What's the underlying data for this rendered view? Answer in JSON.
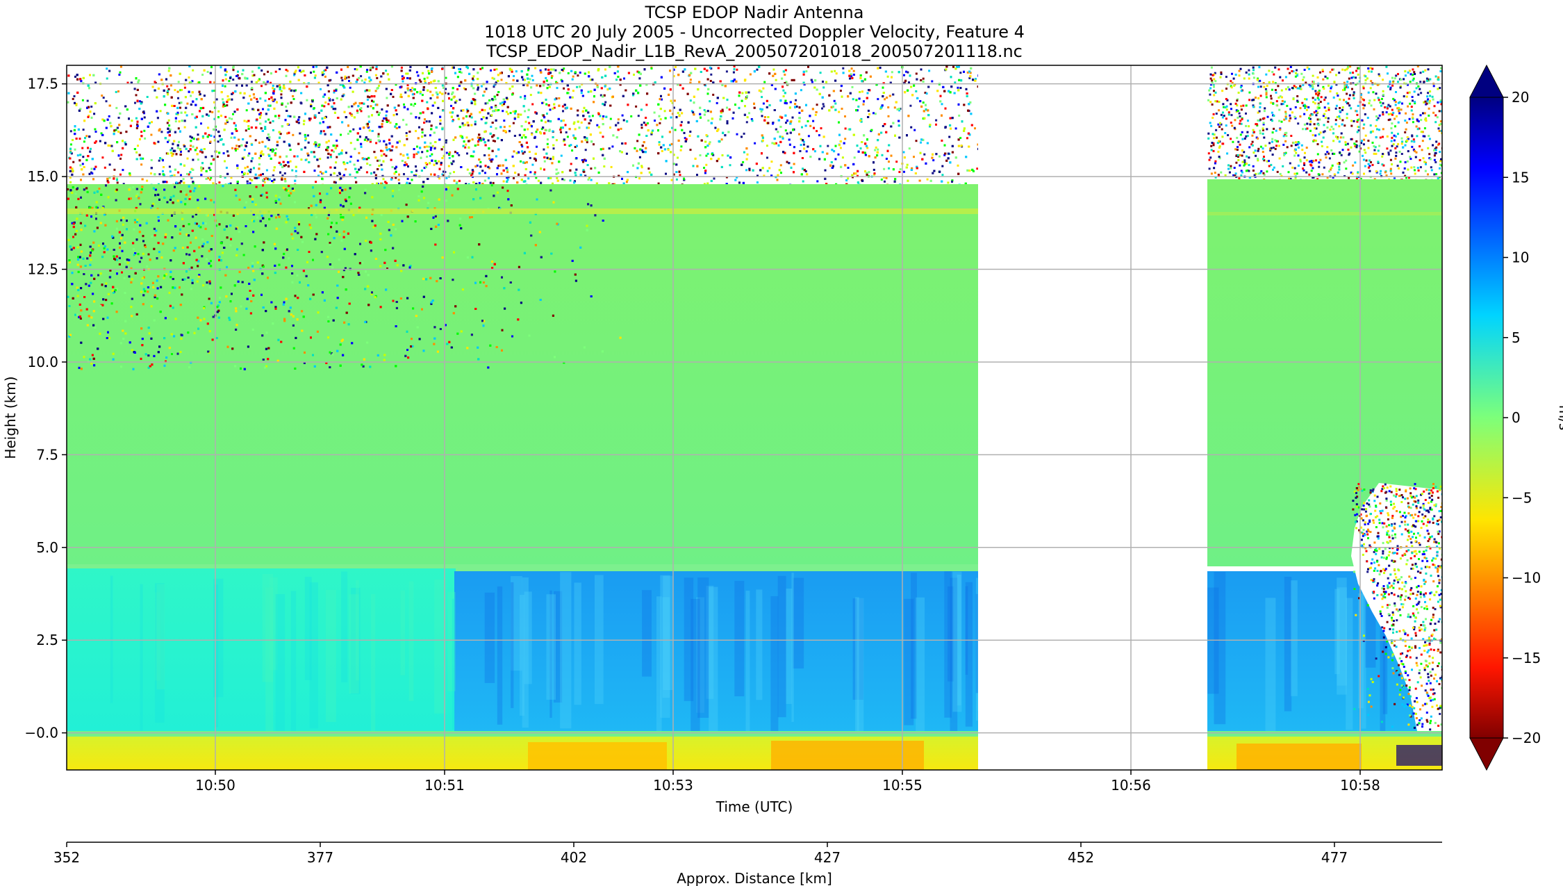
{
  "chart_data": {
    "type": "heatmap",
    "title_lines": [
      "TCSP EDOP Nadir Antenna",
      "1018 UTC 20 July 2005 - Uncorrected Doppler Velocity, Feature 4",
      "TCSP_EDOP_Nadir_L1B_RevA_200507201018_200507201118.nc"
    ],
    "xlabel": "Time (UTC)",
    "ylabel": "Height (km)",
    "x2label": "Approx. Distance [km]",
    "colorbar_label": "m/s",
    "x_ticks": [
      "10:50",
      "10:51",
      "10:53",
      "10:55",
      "10:56",
      "10:58"
    ],
    "x2_ticks": [
      "352",
      "377",
      "402",
      "427",
      "452",
      "477"
    ],
    "y_ticks": [
      "−0.0",
      "2.5",
      "5.0",
      "7.5",
      "10.0",
      "12.5",
      "15.0",
      "17.5"
    ],
    "colorbar_ticks": [
      "−20",
      "−15",
      "−10",
      "−5",
      "0",
      "5",
      "10",
      "15",
      "20"
    ],
    "ylim": [
      -1.0,
      18.0
    ],
    "clim": [
      -20,
      20
    ],
    "colormap": "jet_r",
    "grid": true,
    "data_gap": [
      "10:55",
      "10:57"
    ],
    "regions": [
      {
        "name": "upper noise",
        "height_km": [
          10.5,
          18.0
        ],
        "velocity_ms": 0
      },
      {
        "name": "stratiform layer",
        "height_km": [
          4.5,
          14.6
        ],
        "velocity_ms": -1
      },
      {
        "name": "bright band / melting layer",
        "height_km": [
          4.3,
          4.5
        ],
        "velocity_ms": -2
      },
      {
        "name": "rain (left)",
        "height_km": [
          0.0,
          4.3
        ],
        "velocity_ms": 4
      },
      {
        "name": "rain (heavy)",
        "height_km": [
          0.0,
          4.3
        ],
        "velocity_ms": 8
      },
      {
        "name": "surface return",
        "height_km": [
          -1.0,
          -0.1
        ],
        "velocity_ms": -6
      }
    ]
  }
}
